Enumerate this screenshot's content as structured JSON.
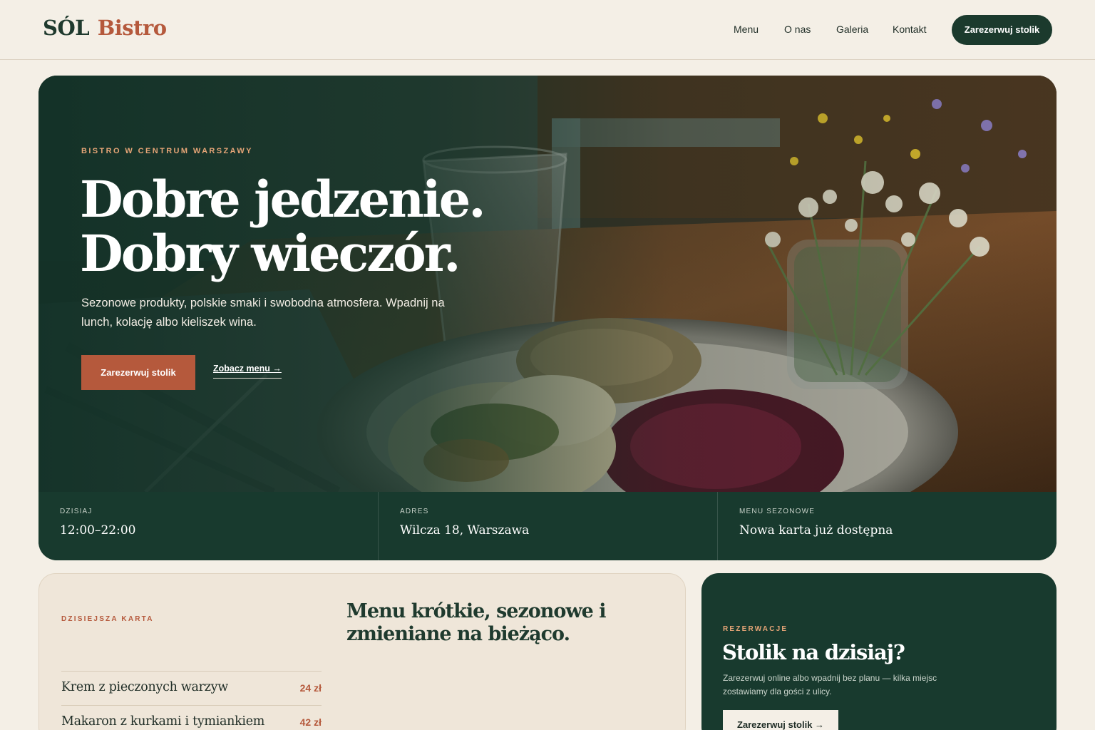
{
  "brand": {
    "name_part1": "SÓL",
    "name_part2": "Bistro"
  },
  "nav": {
    "links": [
      "Menu",
      "O nas",
      "Galeria",
      "Kontakt"
    ],
    "cta": "Zarezerwuj stolik"
  },
  "hero": {
    "eyebrow": "BISTRO W CENTRUM WARSZAWY",
    "title_line1": "Dobre jedzenie.",
    "title_line2": "Dobry wieczór.",
    "description": "Sezonowe produkty, polskie smaki i swobodna atmosfera. Wpadnij na lunch, kolację albo kieliszek wina.",
    "primary_button": "Zarezerwuj stolik",
    "secondary_link": "Zobacz menu →"
  },
  "info": [
    {
      "label": "DZISIAJ",
      "value": "12:00–22:00"
    },
    {
      "label": "ADRES",
      "value": "Wilcza 18, Warszawa"
    },
    {
      "label": "MENU SEZONOWE",
      "value": "Nowa karta już dostępna"
    }
  ],
  "menu": {
    "eyebrow": "DZISIEJSZA KARTA",
    "heading": "Menu krótkie, sezonowe i zmieniane na bieżąco.",
    "items": [
      {
        "name": "Krem z pieczonych warzyw",
        "price": "24 zł"
      },
      {
        "name": "Makaron z kurkami i tymiankiem",
        "price": "42 zł"
      }
    ]
  },
  "reservation": {
    "eyebrow": "REZERWACJE",
    "title": "Stolik na dzisiaj?",
    "description": "Zarezerwuj online albo wpadnij bez planu — kilka miejsc zostawiamy dla gości z ulicy.",
    "button": "Zarezerwuj stolik →"
  },
  "colors": {
    "background": "#f4efe6",
    "dark_green": "#183a2e",
    "terracotta": "#b5593c",
    "accent_peach": "#e6a577"
  }
}
